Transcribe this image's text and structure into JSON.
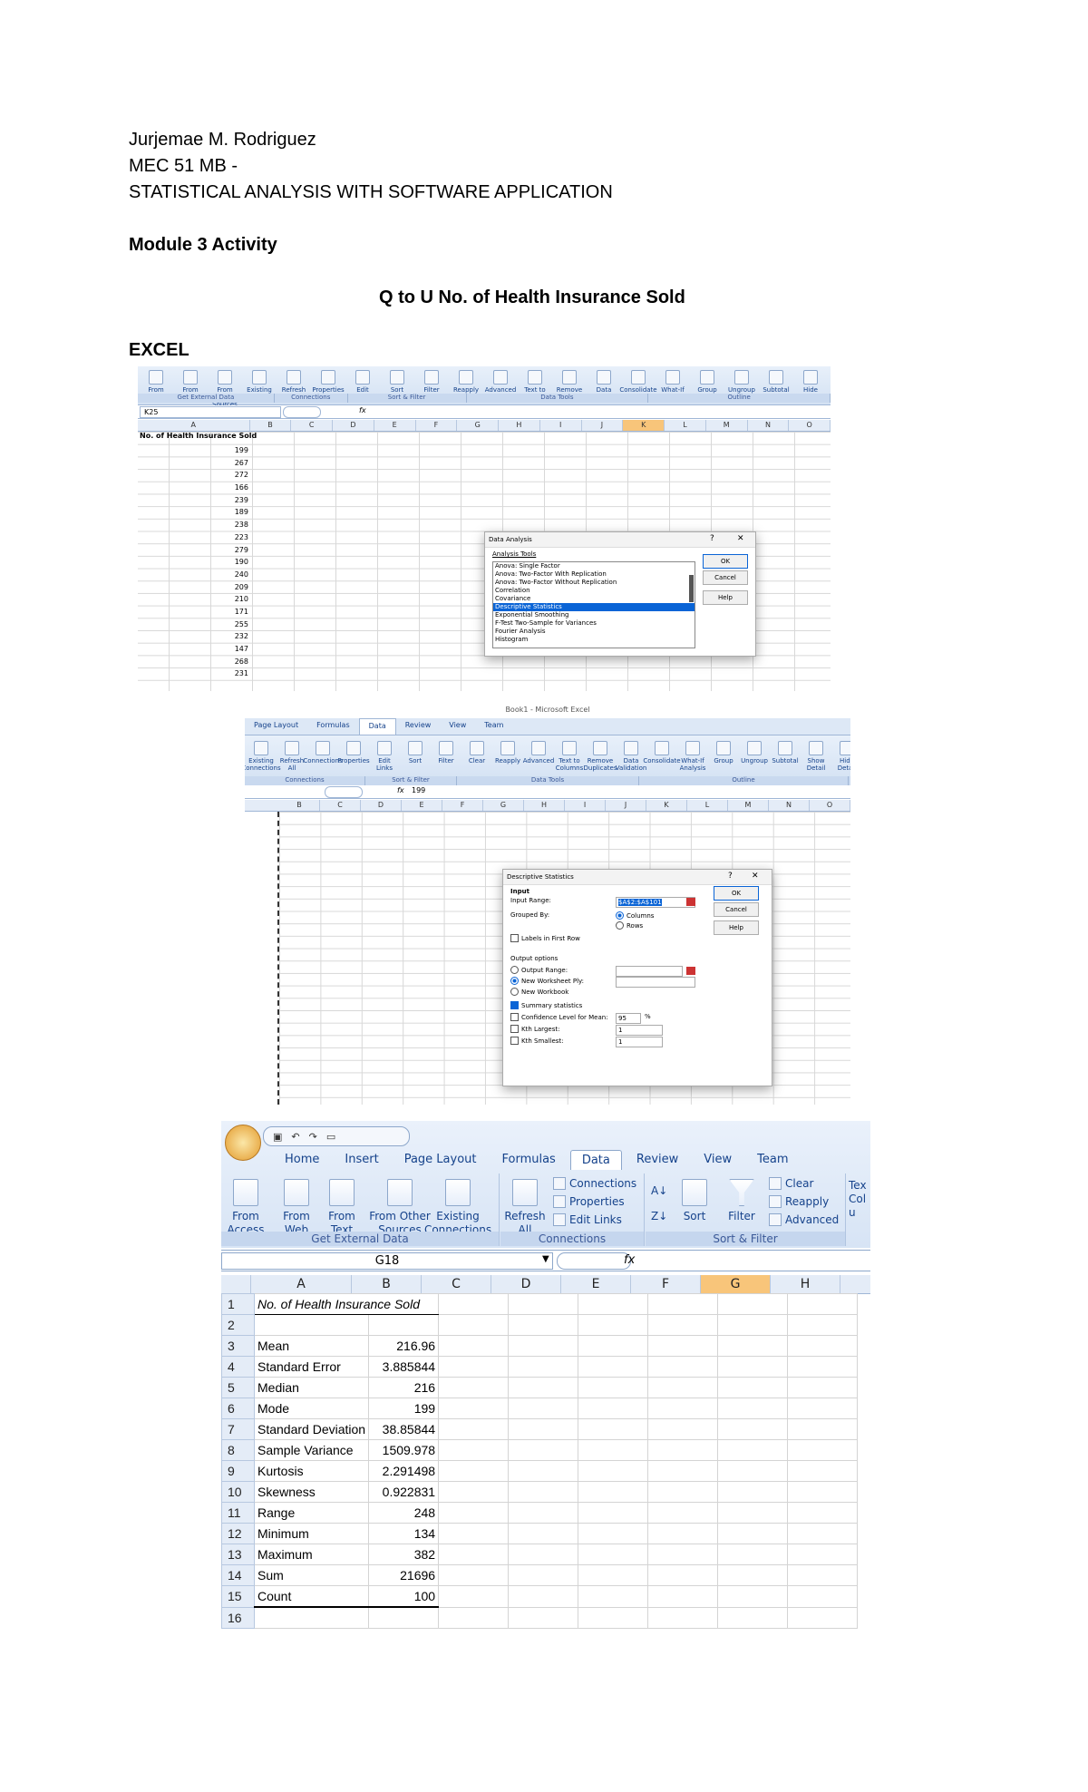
{
  "doc": {
    "author": "Jurjemae M. Rodriguez",
    "course_code": "MEC 51 MB -",
    "course_title": "STATISTICAL ANALYSIS WITH SOFTWARE APPLICATION",
    "activity": "Module 3 Activity",
    "heading": "Q to U  No. of Health Insurance Sold",
    "section": "EXCEL"
  },
  "shot1": {
    "ribbon_items": [
      "From Web",
      "From Text",
      "From Other Sources",
      "Existing Connections",
      "Refresh All",
      "Properties",
      "Edit Links",
      "Sort",
      "Filter",
      "Reapply",
      "Advanced",
      "Text to Columns",
      "Remove Duplicates",
      "Data Validation",
      "Consolidate",
      "What-If Analysis",
      "Group",
      "Ungroup",
      "Subtotal",
      "Hide Detail"
    ],
    "groups": [
      "Get External Data",
      "Connections",
      "Sort & Filter",
      "Data Tools",
      "Outline"
    ],
    "name_box": "K25",
    "fx": "fx",
    "columns": [
      "A",
      "B",
      "C",
      "D",
      "E",
      "F",
      "G",
      "H",
      "I",
      "J",
      "K",
      "L",
      "M",
      "N",
      "O"
    ],
    "header_cell": "No. of Health Insurance Sold",
    "values": [
      "199",
      "267",
      "272",
      "166",
      "239",
      "189",
      "238",
      "223",
      "279",
      "190",
      "240",
      "209",
      "210",
      "171",
      "255",
      "232",
      "147",
      "268",
      "231"
    ],
    "dialog": {
      "title": "Data Analysis",
      "question": "?",
      "close": "✕",
      "list_label": "Analysis Tools",
      "tools": [
        "Anova: Single Factor",
        "Anova: Two-Factor With Replication",
        "Anova: Two-Factor Without Replication",
        "Correlation",
        "Covariance",
        "Descriptive Statistics",
        "Exponential Smoothing",
        "F-Test Two-Sample for Variances",
        "Fourier Analysis",
        "Histogram"
      ],
      "selected_index": 5,
      "ok": "OK",
      "cancel": "Cancel",
      "help": "Help"
    }
  },
  "shot2": {
    "window_title": "Book1 - Microsoft Excel",
    "tabs": [
      "Page Layout",
      "Formulas",
      "Data",
      "Review",
      "View",
      "Team"
    ],
    "active_tab": "Data",
    "groups": [
      "Connections",
      "Sort & Filter",
      "Data Tools",
      "Outline"
    ],
    "ribbon_items": [
      "Existing Connections",
      "Refresh All",
      "Connections",
      "Properties",
      "Edit Links",
      "Sort",
      "Filter",
      "Clear",
      "Reapply",
      "Advanced",
      "Text to Columns",
      "Remove Duplicates",
      "Data Validation",
      "Consolidate",
      "What-If Analysis",
      "Group",
      "Ungroup",
      "Subtotal",
      "Show Detail",
      "Hide Detail"
    ],
    "formula_value": "199",
    "fx": "fx",
    "columns": [
      "B",
      "C",
      "D",
      "E",
      "F",
      "G",
      "H",
      "I",
      "J",
      "K",
      "L",
      "M",
      "N",
      "O"
    ],
    "dialog": {
      "title": "Descriptive Statistics",
      "question": "?",
      "close": "✕",
      "input_label": "Input",
      "input_range_label": "Input Range:",
      "input_range_value": "$A$2:$A$101",
      "grouped_by_label": "Grouped By:",
      "columns_option": "Columns",
      "rows_option": "Rows",
      "labels_first_row": "Labels in First Row",
      "output_options": "Output options",
      "output_range": "Output Range:",
      "new_worksheet": "New Worksheet Ply:",
      "new_workbook": "New Workbook",
      "summary_statistics": "Summary statistics",
      "confidence_level": "Confidence Level for Mean:",
      "confidence_value": "95",
      "percent": "%",
      "kth_largest": "Kth Largest:",
      "kth_largest_value": "1",
      "kth_smallest": "Kth Smallest:",
      "kth_smallest_value": "1",
      "ok": "OK",
      "cancel": "Cancel",
      "help": "Help"
    }
  },
  "shot3": {
    "tabs": [
      "Home",
      "Insert",
      "Page Layout",
      "Formulas",
      "Data",
      "Review",
      "View",
      "Team"
    ],
    "active_tab": "Data",
    "get_external": [
      "From Access",
      "From Web",
      "From Text",
      "From Other Sources",
      "Existing Connections"
    ],
    "get_external_group": "Get External Data",
    "refresh": "Refresh All",
    "connections_items": [
      "Connections",
      "Properties",
      "Edit Links"
    ],
    "connections_group": "Connections",
    "sort": "Sort",
    "filter": "Filter",
    "filter_items": [
      "Clear",
      "Reapply",
      "Advanced"
    ],
    "sort_group": "Sort & Filter",
    "partial_label": "Tex Colu",
    "name_box": "G18",
    "fx": "fx",
    "columns": [
      "A",
      "B",
      "C",
      "D",
      "E",
      "F",
      "G",
      "H"
    ],
    "selected_column": "G",
    "header_cell": "No. of Health Insurance Sold",
    "rows": [
      {
        "n": "1",
        "label": "No. of Health Insurance Sold",
        "value": ""
      },
      {
        "n": "2",
        "label": "",
        "value": ""
      },
      {
        "n": "3",
        "label": "Mean",
        "value": "216.96"
      },
      {
        "n": "4",
        "label": "Standard Error",
        "value": "3.885844"
      },
      {
        "n": "5",
        "label": "Median",
        "value": "216"
      },
      {
        "n": "6",
        "label": "Mode",
        "value": "199"
      },
      {
        "n": "7",
        "label": "Standard Deviation",
        "value": "38.85844"
      },
      {
        "n": "8",
        "label": "Sample Variance",
        "value": "1509.978"
      },
      {
        "n": "9",
        "label": "Kurtosis",
        "value": "2.291498"
      },
      {
        "n": "10",
        "label": "Skewness",
        "value": "0.922831"
      },
      {
        "n": "11",
        "label": "Range",
        "value": "248"
      },
      {
        "n": "12",
        "label": "Minimum",
        "value": "134"
      },
      {
        "n": "13",
        "label": "Maximum",
        "value": "382"
      },
      {
        "n": "14",
        "label": "Sum",
        "value": "21696"
      },
      {
        "n": "15",
        "label": "Count",
        "value": "100"
      },
      {
        "n": "16",
        "label": "",
        "value": ""
      }
    ]
  }
}
